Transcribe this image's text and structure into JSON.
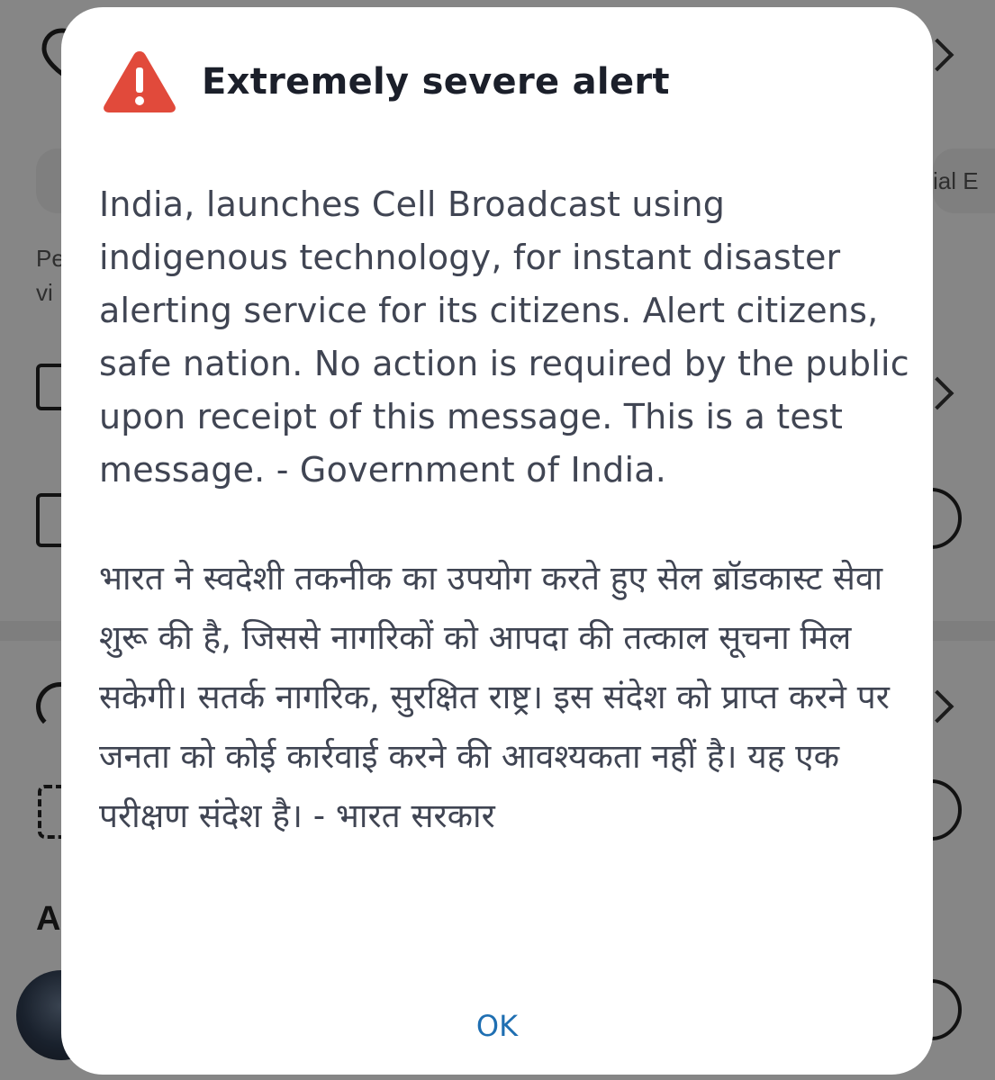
{
  "background": {
    "partial_texts": {
      "chip_right": "ial E",
      "item_line_1": "Pe",
      "item_line_2": "vi",
      "section_letter": "A"
    }
  },
  "dialog": {
    "icon": "warning-triangle-icon",
    "icon_color": "#e14a3b",
    "title": "Extremely severe alert",
    "message_en": "India, launches Cell Broadcast using indigenous technology, for instant disaster alerting service for its citizens. Alert citizens, safe nation. No action is required by the public upon receipt of this message. This is a test message. - Government of India.",
    "message_hi": "भारत ने स्वदेशी तकनीक का उपयोग करते हुए सेल ब्रॉडकास्ट सेवा शुरू की है, जिससे नागरिकों को आपदा की तत्काल सूचना मिल सकेगी। सतर्क नागरिक, सुरक्षित राष्ट्र। इस संदेश को प्राप्त करने पर जनता को कोई कार्रवाई करने की आवश्यकता नहीं है। यह एक परीक्षण संदेश है। - भारत सरकार",
    "ok_label": "OK",
    "ok_color": "#1f6fb2"
  }
}
